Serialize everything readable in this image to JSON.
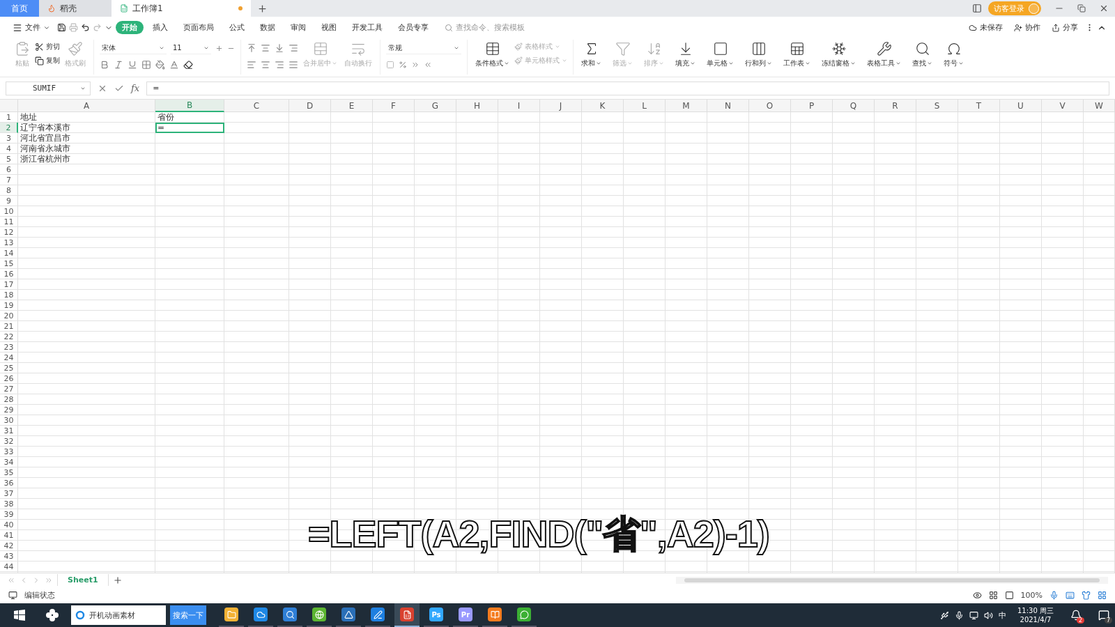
{
  "title_tabs": [
    {
      "label": "首页",
      "kind": "home",
      "selected": false
    },
    {
      "label": "稻壳",
      "kind": "docer",
      "selected": false
    },
    {
      "label": "工作簿1",
      "kind": "sheet",
      "selected": true,
      "unsaved": true
    }
  ],
  "account": {
    "label": "访客登录"
  },
  "menu": {
    "file": "文件",
    "tabs": [
      {
        "label": "开始",
        "selected": true
      },
      {
        "label": "插入",
        "selected": false
      },
      {
        "label": "页面布局",
        "selected": false
      },
      {
        "label": "公式",
        "selected": false
      },
      {
        "label": "数据",
        "selected": false
      },
      {
        "label": "审阅",
        "selected": false
      },
      {
        "label": "视图",
        "selected": false
      },
      {
        "label": "开发工具",
        "selected": false
      },
      {
        "label": "会员专享",
        "selected": false
      }
    ],
    "search": {
      "placeholder": "查找命令、搜索模板"
    },
    "actions": [
      "未保存",
      "协作",
      "分享"
    ]
  },
  "ribbon": {
    "clipboard": [
      {
        "label": "粘贴",
        "kind": "big",
        "disabled": true
      },
      {
        "label": "剪切",
        "kind": "small",
        "disabled": false
      },
      {
        "label": "复制",
        "kind": "small",
        "disabled": false
      },
      {
        "label": "格式刷",
        "kind": "big",
        "disabled": true
      }
    ],
    "font": {
      "name": "宋体",
      "size": "11"
    },
    "align": [
      {
        "label": "合并居中",
        "disabled": true
      },
      {
        "label": "自动换行",
        "disabled": true
      }
    ],
    "number_format": "常规",
    "styles": [
      {
        "label": "条件格式",
        "kind": "big",
        "disabled": false
      },
      {
        "label": "表格样式",
        "kind": "small",
        "disabled": true
      },
      {
        "label": "单元格样式",
        "kind": "small",
        "disabled": true
      }
    ],
    "tools": [
      {
        "label": "求和",
        "disabled": false
      },
      {
        "label": "筛选",
        "disabled": true
      },
      {
        "label": "排序",
        "disabled": true
      },
      {
        "label": "填充",
        "disabled": false
      },
      {
        "label": "单元格",
        "disabled": false
      },
      {
        "label": "行和列",
        "disabled": false
      },
      {
        "label": "工作表",
        "disabled": false
      },
      {
        "label": "冻结窗格",
        "disabled": false
      },
      {
        "label": "表格工具",
        "disabled": false
      },
      {
        "label": "查找",
        "disabled": false
      },
      {
        "label": "符号",
        "disabled": false
      }
    ]
  },
  "formula_bar": {
    "name_box": "SUMIF",
    "fx": "fx",
    "value": "="
  },
  "sheet": {
    "columns": [
      {
        "label": "A",
        "selected": false
      },
      {
        "label": "B",
        "selected": true
      },
      {
        "label": "C",
        "selected": false
      },
      {
        "label": "D",
        "selected": false
      },
      {
        "label": "E",
        "selected": false
      },
      {
        "label": "F",
        "selected": false
      },
      {
        "label": "G",
        "selected": false
      },
      {
        "label": "H",
        "selected": false
      },
      {
        "label": "I",
        "selected": false
      },
      {
        "label": "J",
        "selected": false
      },
      {
        "label": "K",
        "selected": false
      },
      {
        "label": "L",
        "selected": false
      },
      {
        "label": "M",
        "selected": false
      },
      {
        "label": "N",
        "selected": false
      },
      {
        "label": "O",
        "selected": false
      },
      {
        "label": "P",
        "selected": false
      },
      {
        "label": "Q",
        "selected": false
      },
      {
        "label": "R",
        "selected": false
      },
      {
        "label": "S",
        "selected": false
      },
      {
        "label": "T",
        "selected": false
      },
      {
        "label": "U",
        "selected": false
      },
      {
        "label": "V",
        "selected": false
      },
      {
        "label": "W",
        "selected": false
      }
    ],
    "rows": [
      {
        "label": "1",
        "selected": false,
        "cells": [
          {
            "text": "地址",
            "selected": false
          },
          {
            "text": "省份",
            "selected": false
          }
        ]
      },
      {
        "label": "2",
        "selected": true,
        "cells": [
          {
            "text": "辽宁省本溪市",
            "selected": false
          },
          {
            "text": "=",
            "selected": true
          }
        ]
      },
      {
        "label": "3",
        "selected": false,
        "cells": [
          {
            "text": "河北省宜昌市",
            "selected": false
          }
        ]
      },
      {
        "label": "4",
        "selected": false,
        "cells": [
          {
            "text": "河南省永城市",
            "selected": false
          }
        ]
      },
      {
        "label": "5",
        "selected": false,
        "cells": [
          {
            "text": "浙江省杭州市",
            "selected": false
          }
        ]
      },
      {
        "label": "6",
        "selected": false
      },
      {
        "label": "7",
        "selected": false
      },
      {
        "label": "8",
        "selected": false
      },
      {
        "label": "9",
        "selected": false
      },
      {
        "label": "10",
        "selected": false
      },
      {
        "label": "11",
        "selected": false
      },
      {
        "label": "12",
        "selected": false
      },
      {
        "label": "13",
        "selected": false
      },
      {
        "label": "14",
        "selected": false
      },
      {
        "label": "15",
        "selected": false
      },
      {
        "label": "16",
        "selected": false
      },
      {
        "label": "17",
        "selected": false
      },
      {
        "label": "18",
        "selected": false
      },
      {
        "label": "19",
        "selected": false
      },
      {
        "label": "20",
        "selected": false
      },
      {
        "label": "21",
        "selected": false
      },
      {
        "label": "22",
        "selected": false
      },
      {
        "label": "23",
        "selected": false
      },
      {
        "label": "24",
        "selected": false
      },
      {
        "label": "25",
        "selected": false
      },
      {
        "label": "26",
        "selected": false
      },
      {
        "label": "27",
        "selected": false
      },
      {
        "label": "28",
        "selected": false
      },
      {
        "label": "29",
        "selected": false
      },
      {
        "label": "30",
        "selected": false
      },
      {
        "label": "31",
        "selected": false
      },
      {
        "label": "32",
        "selected": false
      },
      {
        "label": "33",
        "selected": false
      },
      {
        "label": "34",
        "selected": false
      },
      {
        "label": "35",
        "selected": false
      },
      {
        "label": "36",
        "selected": false
      },
      {
        "label": "37",
        "selected": false
      },
      {
        "label": "38",
        "selected": false
      },
      {
        "label": "39",
        "selected": false
      },
      {
        "label": "40",
        "selected": false
      },
      {
        "label": "41",
        "selected": false
      },
      {
        "label": "42",
        "selected": false
      },
      {
        "label": "43",
        "selected": false
      },
      {
        "label": "44",
        "selected": false
      }
    ],
    "sheet_tabs": [
      {
        "label": "Sheet1",
        "selected": true
      }
    ]
  },
  "caption": "=LEFT(A2,FIND(\"省\",A2)-1)",
  "status_bar": {
    "mode": "编辑状态",
    "zoom": "100%"
  },
  "taskbar": {
    "search_value": "开机动画素材",
    "search_button": "搜索一下",
    "apps": [
      {
        "kind": "folder",
        "color": "#f2b134",
        "active": false
      },
      {
        "kind": "browser",
        "color": "#1e88e5",
        "active": false
      },
      {
        "kind": "sogou",
        "color": "#2f7fd6",
        "active": false
      },
      {
        "kind": "ie",
        "color": "#5cb531",
        "active": false
      },
      {
        "kind": "arrow",
        "color": "#2a6fb8",
        "active": false
      },
      {
        "kind": "note",
        "color": "#1e7fe0",
        "active": false
      },
      {
        "kind": "wps",
        "color": "#d9412f",
        "active": true
      },
      {
        "kind": "ps",
        "label": "Ps",
        "color": "#31a8ff",
        "active": false
      },
      {
        "kind": "pr",
        "label": "Pr",
        "color": "#9999ff",
        "active": false
      },
      {
        "kind": "book",
        "color": "#f57c1f",
        "active": false
      },
      {
        "kind": "chat",
        "color": "#3cb034",
        "active": false
      }
    ],
    "ime": "中",
    "time": "11:30 周三",
    "date": "2021/4/7",
    "badges": [
      "2",
      "7"
    ]
  }
}
